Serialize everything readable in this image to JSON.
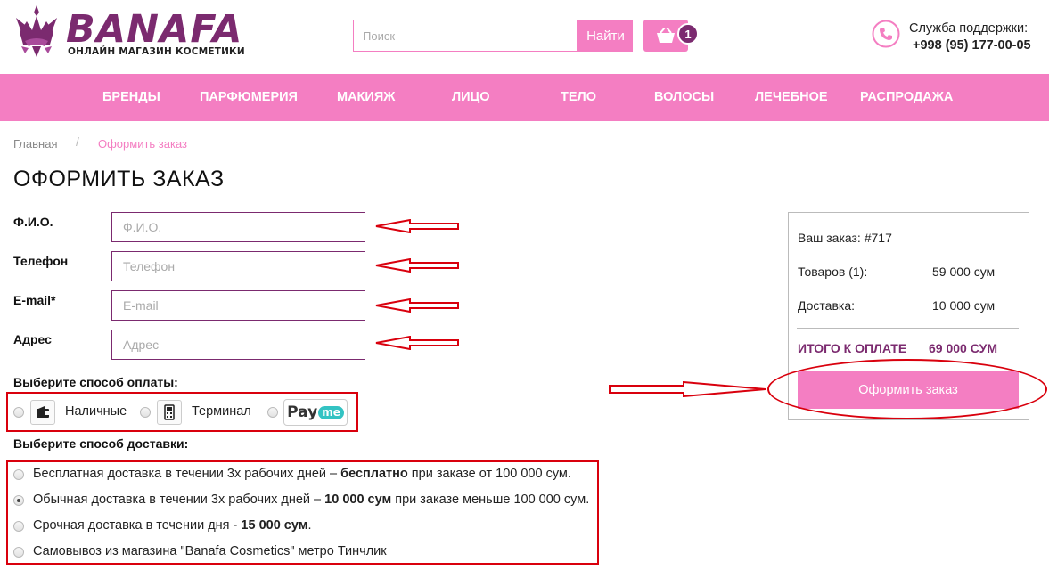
{
  "header": {
    "logo_title": "BANAFA",
    "logo_subtitle": "ОНЛАЙН МАГАЗИН КОСМЕТИКИ",
    "search_placeholder": "Поиск",
    "search_button": "Найти",
    "cart_count": "1",
    "support_label": "Служба поддержки:",
    "support_phone": "+998 (95) 177-00-05"
  },
  "nav": {
    "items": [
      {
        "label": "БРЕНДЫ"
      },
      {
        "label": "ПАРФЮМЕРИЯ"
      },
      {
        "label": "МАКИЯЖ"
      },
      {
        "label": "ЛИЦО"
      },
      {
        "label": "ТЕЛО"
      },
      {
        "label": "ВОЛОСЫ"
      },
      {
        "label": "ЛЕЧЕБНОЕ"
      },
      {
        "label": "РАСПРОДАЖА"
      }
    ]
  },
  "breadcrumb": {
    "home": "Главная",
    "separator": "/",
    "current": "Оформить заказ"
  },
  "page_title": "ОФОРМИТЬ ЗАКАЗ",
  "form": {
    "fields": [
      {
        "label": "Ф.И.О.",
        "placeholder": "Ф.И.О.",
        "value": ""
      },
      {
        "label": "Телефон",
        "placeholder": "Телефон",
        "value": ""
      },
      {
        "label": "E-mail*",
        "placeholder": "E-mail",
        "value": ""
      },
      {
        "label": "Адрес",
        "placeholder": "Адрес",
        "value": ""
      }
    ]
  },
  "payment": {
    "title": "Выберите способ оплаты:",
    "options": [
      {
        "label": "Наличные",
        "icon": "wallet-icon",
        "selected": false
      },
      {
        "label": "Терминал",
        "icon": "pos-terminal-icon",
        "selected": false
      },
      {
        "label": "Pay",
        "label_suffix": "me",
        "icon": "payme-logo",
        "selected": false
      }
    ]
  },
  "delivery": {
    "title": "Выберите способ доставки:",
    "options": [
      {
        "pre": "Бесплатная доставка в течении 3х рабочих дней – ",
        "bold": "бесплатно",
        "post": " при заказе от 100 000 сум.",
        "selected": false
      },
      {
        "pre": "Обычная доставка в течении 3х рабочих дней – ",
        "bold": "10 000 сум",
        "post": " при заказе меньше 100 000 сум.",
        "selected": true
      },
      {
        "pre": "Срочная доставка в течении дня - ",
        "bold": "15 000 сум",
        "post": ".",
        "selected": false
      },
      {
        "pre": "Самовывоз из магазина \"Banafa Cosmetics\" метро Тинчлик",
        "bold": "",
        "post": "",
        "selected": false
      }
    ]
  },
  "summary": {
    "order_label": "Ваш заказ: #717",
    "items_label": "Товаров (1):",
    "items_value": "59 000 сум",
    "delivery_label": "Доставка:",
    "delivery_value": "10 000 сум",
    "total_label": "ИТОГО К ОПЛАТЕ",
    "total_value": "69 000 СУМ",
    "submit_button": "Оформить заказ"
  },
  "colors": {
    "brand_pink": "#f47ec2",
    "brand_purple": "#7b2a6f",
    "annotation_red": "#d9000d"
  }
}
